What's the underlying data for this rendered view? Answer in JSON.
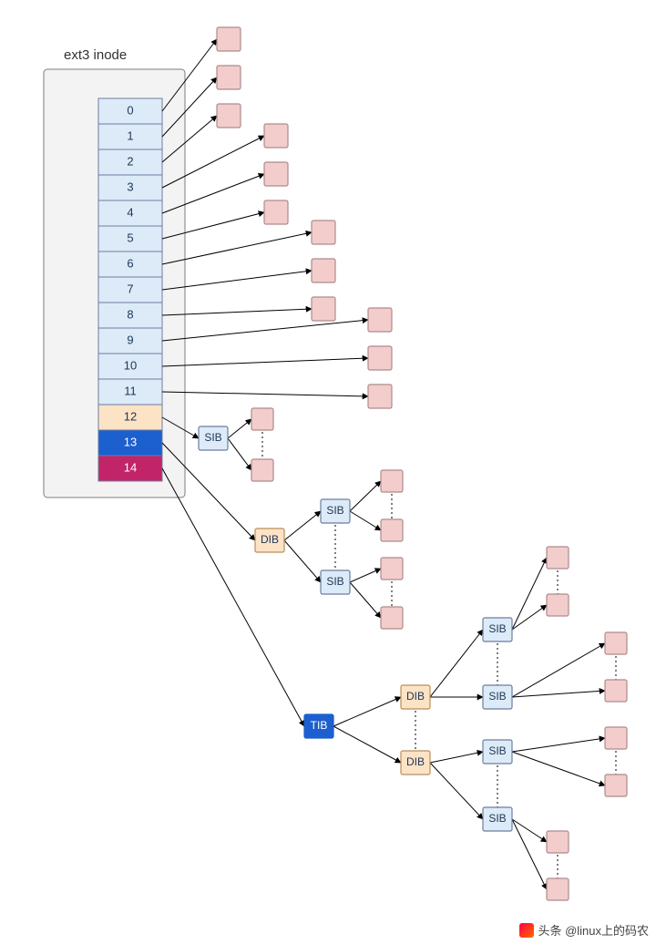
{
  "title": "ext3 inode",
  "watermark": "头条 @linux上的码农",
  "colors": {
    "direct": "#dcebf7",
    "single": "#fde3c5",
    "double": "#1c5fce",
    "triple": "#c12468",
    "block": "#f3cccc"
  },
  "inode_entries": [
    {
      "idx": "0",
      "kind": "direct"
    },
    {
      "idx": "1",
      "kind": "direct"
    },
    {
      "idx": "2",
      "kind": "direct"
    },
    {
      "idx": "3",
      "kind": "direct"
    },
    {
      "idx": "4",
      "kind": "direct"
    },
    {
      "idx": "5",
      "kind": "direct"
    },
    {
      "idx": "6",
      "kind": "direct"
    },
    {
      "idx": "7",
      "kind": "direct"
    },
    {
      "idx": "8",
      "kind": "direct"
    },
    {
      "idx": "9",
      "kind": "direct"
    },
    {
      "idx": "10",
      "kind": "direct"
    },
    {
      "idx": "11",
      "kind": "direct"
    },
    {
      "idx": "12",
      "kind": "single"
    },
    {
      "idx": "13",
      "kind": "double"
    },
    {
      "idx": "14",
      "kind": "triple"
    }
  ],
  "labels": {
    "SIB": "SIB",
    "DIB": "DIB",
    "TIB": "TIB"
  },
  "chart_data": {
    "type": "diagram",
    "note": "ext3 inode block-pointer layout",
    "entries": 15,
    "direct_pointers": {
      "range": "0-11",
      "count": 12,
      "points_to": "data block"
    },
    "single_indirect": {
      "index": 12,
      "levels": [
        "SIB",
        "data block"
      ]
    },
    "double_indirect": {
      "index": 13,
      "levels": [
        "DIB",
        "SIB",
        "data block"
      ]
    },
    "triple_indirect": {
      "index": 14,
      "levels": [
        "TIB",
        "DIB",
        "SIB",
        "data block"
      ]
    }
  }
}
